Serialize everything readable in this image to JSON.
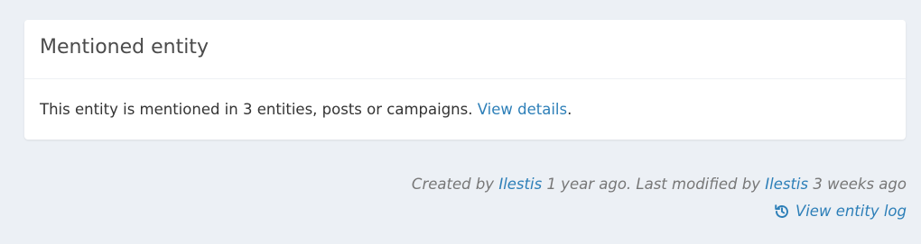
{
  "card": {
    "title": "Mentioned entity",
    "body_text": "This entity is mentioned in 3 entities, posts or campaigns.",
    "view_details_label": "View details",
    "body_suffix": "."
  },
  "meta": {
    "created_prefix": "Created by",
    "created_user": "Ilestis",
    "created_when": "1 year ago. Last modified by",
    "modified_user": "Ilestis",
    "modified_when": "3 weeks ago",
    "log_icon": "history-icon",
    "log_label": "View entity log"
  },
  "colors": {
    "background": "#ecf0f5",
    "link": "#2d7fb8",
    "muted": "#777777"
  }
}
